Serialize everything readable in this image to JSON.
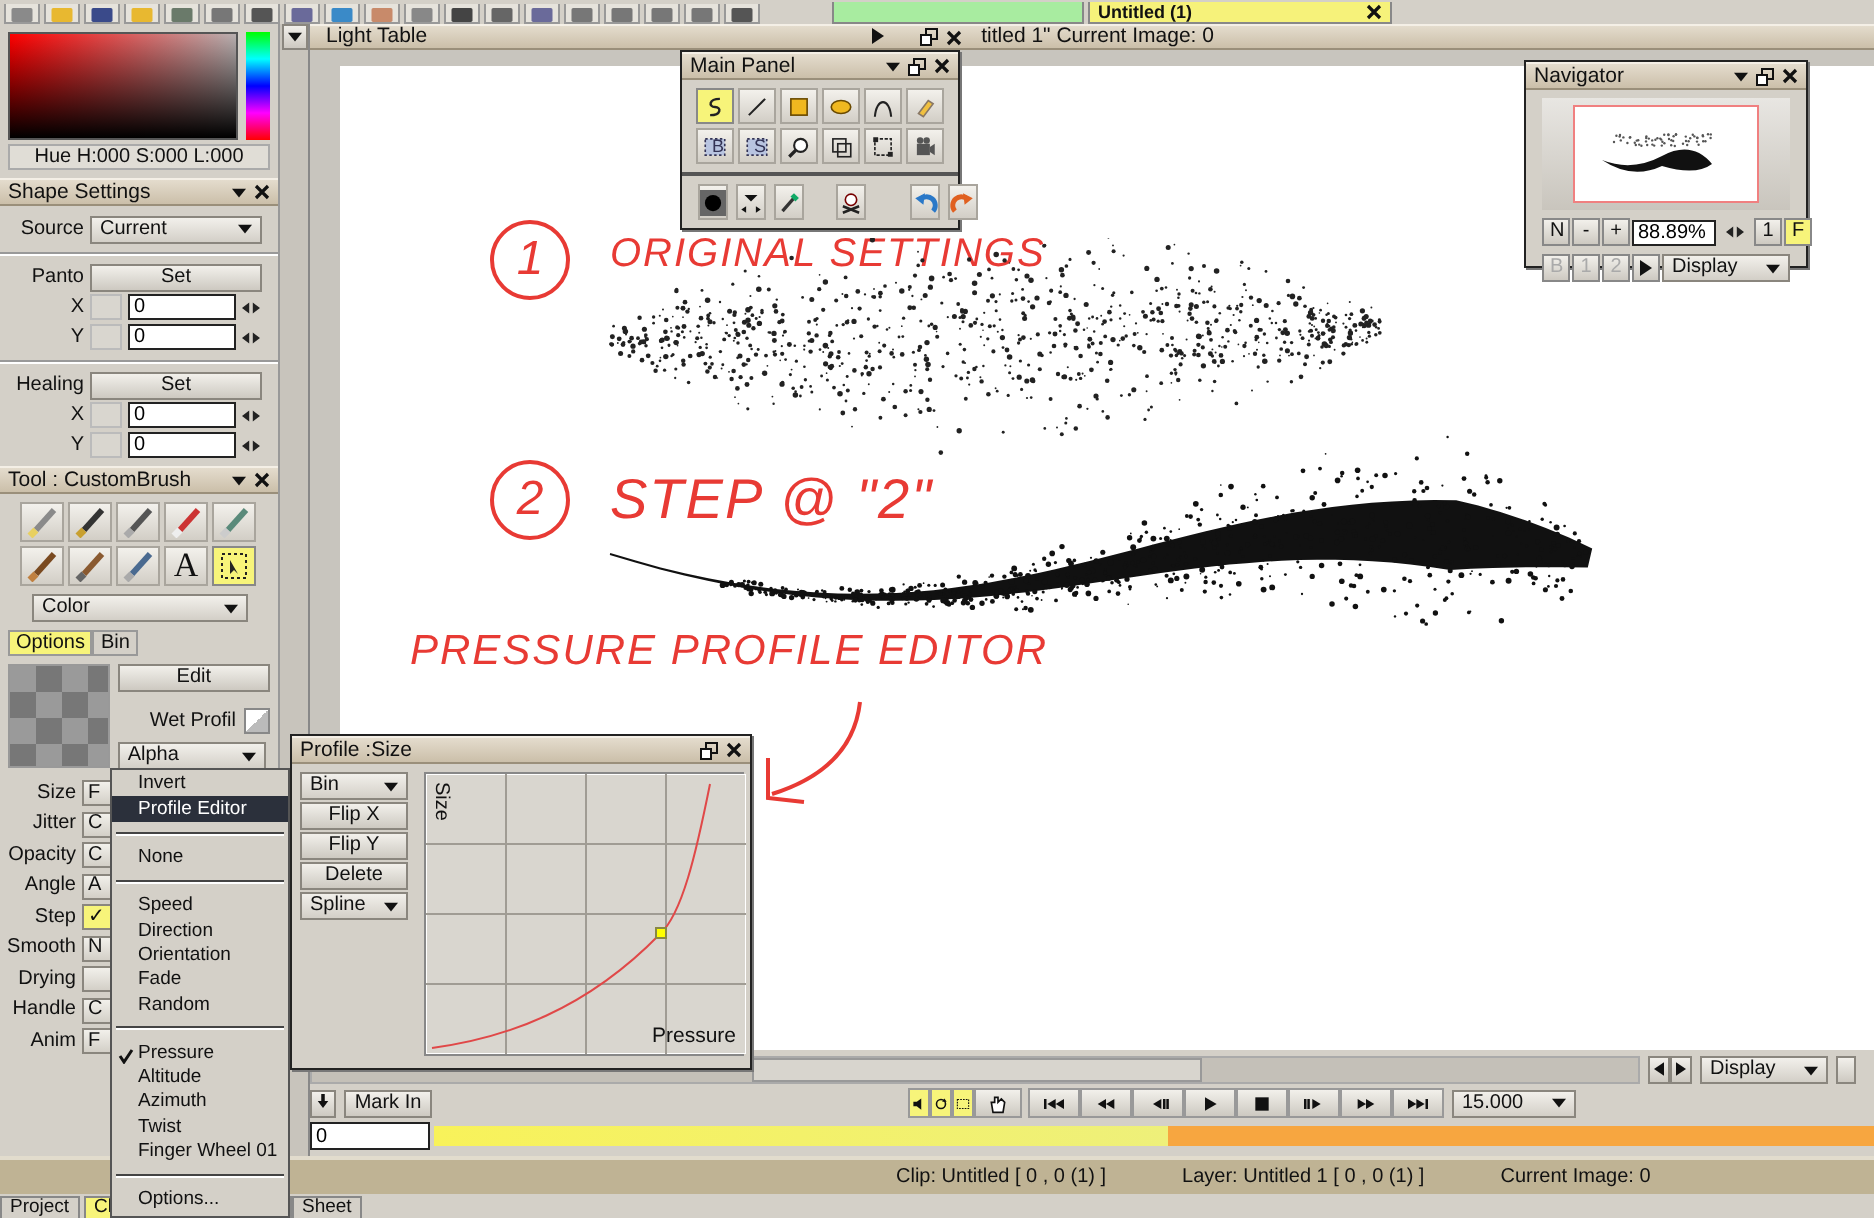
{
  "top_toolbar": {
    "icons": [
      {
        "color": "#8a8a8a"
      },
      {
        "color": "#e8b830"
      },
      {
        "color": "#3a4a8a"
      },
      {
        "color": "#e8b830"
      },
      {
        "color": "#6a7a6a"
      },
      {
        "color": "#777777"
      },
      {
        "color": "#555555"
      },
      {
        "color": "#6a6a9a"
      },
      {
        "color": "#3a8ac8"
      },
      {
        "color": "#c88a6a"
      },
      {
        "color": "#888888"
      },
      {
        "color": "#444444"
      },
      {
        "color": "#666666"
      },
      {
        "color": "#6a6a9a"
      },
      {
        "color": "#777777"
      },
      {
        "color": "#777777"
      },
      {
        "color": "#777777"
      },
      {
        "color": "#777777"
      },
      {
        "color": "#555555"
      }
    ],
    "tabs": [
      {
        "color": "#a8eca0"
      },
      {
        "label": "Untitled (1)",
        "color": "#f6f27a"
      }
    ]
  },
  "color_picker": {
    "readout": "Hue H:000 S:000 L:000"
  },
  "shape_settings": {
    "title": "Shape Settings",
    "source_label": "Source",
    "source_value": "Current",
    "groups": [
      {
        "label": "Panto",
        "button": "Set",
        "fields": [
          {
            "label": "X",
            "value": "0"
          },
          {
            "label": "Y",
            "value": "0"
          }
        ]
      },
      {
        "label": "Healing",
        "button": "Set",
        "fields": [
          {
            "label": "X",
            "value": "0"
          },
          {
            "label": "Y",
            "value": "0"
          }
        ]
      }
    ]
  },
  "tool_panel": {
    "title": "Tool : CustomBrush",
    "tools": [
      {
        "kind": "pencil",
        "selected": false
      },
      {
        "kind": "pen",
        "selected": false
      },
      {
        "kind": "marker",
        "selected": false
      },
      {
        "kind": "airbrush",
        "selected": false
      },
      {
        "kind": "crayon",
        "selected": false
      },
      {
        "kind": "brush",
        "selected": false
      },
      {
        "kind": "oilbrush",
        "selected": false
      },
      {
        "kind": "waterbrush",
        "selected": false
      },
      {
        "kind": "text",
        "label": "A",
        "selected": false
      },
      {
        "kind": "select",
        "selected": true
      }
    ],
    "color_mode": "Color",
    "tabs": [
      {
        "label": "Options",
        "selected": true
      },
      {
        "label": "Bin",
        "selected": false
      }
    ],
    "edit_button": "Edit",
    "wet_profile_label": "Wet Profil",
    "source_channel": "Alpha",
    "params": [
      {
        "label": "Size",
        "value": "F",
        "highlighted": false
      },
      {
        "label": "Jitter",
        "value": "C",
        "highlighted": false
      },
      {
        "label": "Opacity",
        "value": "C",
        "highlighted": false
      },
      {
        "label": "Angle",
        "value": "A",
        "highlighted": false
      },
      {
        "label": "Step",
        "value": "✓",
        "highlighted": true
      },
      {
        "label": "Smooth",
        "value": "N",
        "highlighted": false
      },
      {
        "label": "Drying",
        "highlighted": false
      },
      {
        "label": "Handle",
        "value": "C",
        "highlighted": false
      },
      {
        "label": "Anim",
        "value": "F",
        "highlighted": false
      }
    ]
  },
  "context_menu": {
    "groups": [
      [
        {
          "label": "Invert",
          "selected": false,
          "checked": false
        },
        {
          "label": "Profile Editor",
          "selected": true,
          "checked": false
        }
      ],
      [
        {
          "label": "None",
          "selected": false,
          "checked": false
        }
      ],
      [
        {
          "label": "Speed",
          "selected": false,
          "checked": false
        },
        {
          "label": "Direction",
          "selected": false,
          "checked": false
        },
        {
          "label": "Orientation",
          "selected": false,
          "checked": false
        },
        {
          "label": "Fade",
          "selected": false,
          "checked": false
        },
        {
          "label": "Random",
          "selected": false,
          "checked": false
        }
      ],
      [
        {
          "label": "Pressure",
          "selected": false,
          "checked": true
        },
        {
          "label": "Altitude",
          "selected": false,
          "checked": false
        },
        {
          "label": "Azimuth",
          "selected": false,
          "checked": false
        },
        {
          "label": "Twist",
          "selected": false,
          "checked": false
        },
        {
          "label": "Finger Wheel 01",
          "selected": false,
          "checked": false
        }
      ],
      [
        {
          "label": "Options...",
          "selected": false,
          "checked": false
        }
      ]
    ]
  },
  "light_table": {
    "title": "Light Table",
    "info": "titled 1\"  Current Image: 0"
  },
  "annotations": [
    {
      "number": "1",
      "text": "ORIGINAL SETTINGS"
    },
    {
      "number": "2",
      "text": "STEP @ \"2\""
    },
    {
      "text": "PRESSURE PROFILE EDITOR"
    }
  ],
  "main_panel": {
    "title": "Main Panel",
    "tools": [
      {
        "kind": "freehand",
        "selected": true
      },
      {
        "kind": "line",
        "selected": false
      },
      {
        "kind": "rect",
        "selected": false
      },
      {
        "kind": "ellipse",
        "selected": false
      },
      {
        "kind": "bezier",
        "selected": false
      },
      {
        "kind": "eraser",
        "selected": false
      },
      {
        "kind": "selectb",
        "label": "B",
        "selected": false
      },
      {
        "kind": "selects",
        "label": "S",
        "selected": false
      },
      {
        "kind": "zoom",
        "selected": false
      },
      {
        "kind": "crop",
        "selected": false
      },
      {
        "kind": "transform",
        "selected": false
      },
      {
        "kind": "camera",
        "selected": false
      }
    ],
    "bottom_tools": [
      {
        "kind": "swatch"
      },
      {
        "kind": "arrows"
      },
      {
        "kind": "eyedropper"
      },
      {
        "kind": "skull"
      },
      {
        "kind": "undo"
      },
      {
        "kind": "redo"
      }
    ]
  },
  "navigator": {
    "title": "Navigator",
    "buttons": [
      "N",
      "-",
      "+"
    ],
    "zoom": "88.89%",
    "one": "1",
    "fit": {
      "label": "F",
      "selected": true
    },
    "pages": [
      {
        "label": "B",
        "disabled": true
      },
      {
        "label": "1",
        "disabled": true
      },
      {
        "label": "2",
        "disabled": true
      }
    ],
    "display": "Display"
  },
  "profile_window": {
    "title": "Profile :Size",
    "bin": "Bin",
    "buttons": [
      "Flip X",
      "Flip Y",
      "Delete"
    ],
    "interpolation": "Spline",
    "y_label": "Size",
    "x_label": "Pressure"
  },
  "timeline": {
    "display": "Display",
    "mark_in": "Mark In",
    "frame": "0",
    "speed": "15.000",
    "controls": [
      {
        "kind": "sound",
        "on": true
      },
      {
        "kind": "loop",
        "on": true
      },
      {
        "kind": "fit",
        "on": true
      },
      {
        "kind": "hand",
        "on": false
      },
      {
        "kind": "first",
        "on": false
      },
      {
        "kind": "rewind",
        "on": false
      },
      {
        "kind": "stepback",
        "on": false
      },
      {
        "kind": "play",
        "on": false
      },
      {
        "kind": "stop",
        "on": false
      },
      {
        "kind": "stepfwd",
        "on": false
      },
      {
        "kind": "ffwd",
        "on": false
      },
      {
        "kind": "last",
        "on": false
      }
    ]
  },
  "status_bar": {
    "clip": "Clip: Untitled [ 0 , 0  (1) ]",
    "layer": "Layer: Untitled 1 [ 0 , 0  (1) ]",
    "image": "Current Image: 0"
  },
  "bottom_tabs": [
    {
      "label": "Project",
      "selected": false
    },
    {
      "label": "Cl",
      "selected": true
    },
    {
      "label": "Sheet",
      "selected": false
    }
  ]
}
